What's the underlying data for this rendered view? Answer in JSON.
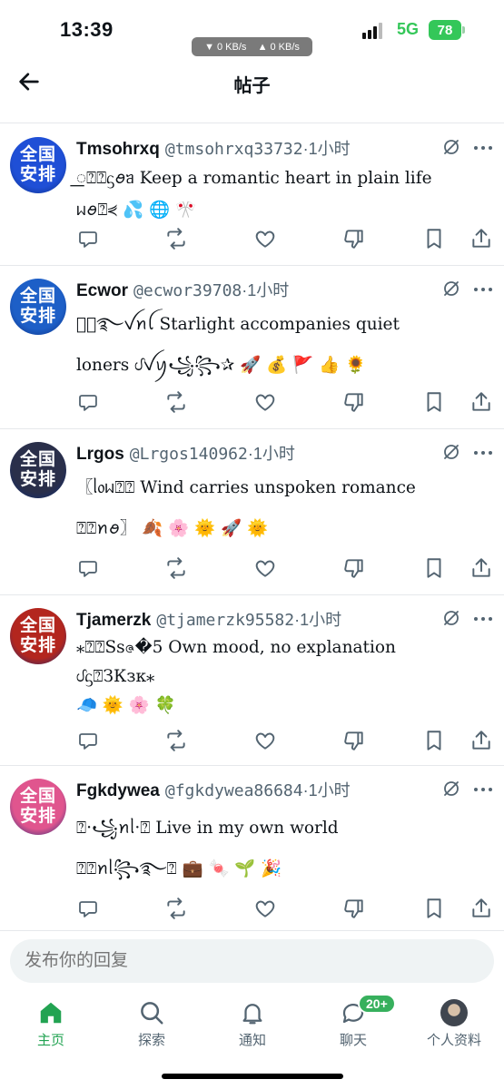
{
  "status_bar": {
    "time": "13:39",
    "net_down": "▼ 0 KB/s",
    "net_up": "▲ 0 KB/s",
    "network": "5G",
    "battery": "78"
  },
  "header": {
    "title": "帖子",
    "back_icon": "arrow-left-icon"
  },
  "posts": [
    {
      "avatar_text_1": "全国",
      "avatar_text_2": "安排",
      "avatar_color": "#1f4fd6",
      "name": "Tmsohrxq",
      "handle": "@tmsohrxq33732",
      "time": "·1小时",
      "text": "꯭⍰⍰ᦓꪮᥑ Keep a romantic heart in plain life\nᥕꪮ⍰⋞ 💦 🌐 🎌"
    },
    {
      "avatar_text_1": "全国",
      "avatar_text_2": "安排",
      "avatar_color": "#1d5fc7",
      "name": "Ecwor",
      "handle": "@ecwor39708",
      "time": "·1小时",
      "text": "✰꯭࿐ꪜꪀꪶ Starlight accompanies quiet\nloners ᦔꪜꪗ꧁꧂✰ 🚀 💰 🚩 👍 🌻"
    },
    {
      "avatar_text_1": "全国",
      "avatar_text_2": "安排",
      "avatar_color": "#2a2f4a",
      "name": "Lrgos",
      "handle": "@Lrgos140962",
      "time": "·1小时",
      "text": "〖ᥣ᥆ᥕ⍰⍰ Wind carries unspoken romance\n⍰⍰ꪀꪮ〗 🍂 🌸 🌞 🚀 🌞"
    },
    {
      "avatar_text_1": "全国",
      "avatar_text_2": "安排",
      "avatar_color": "#b3261e",
      "name": "Tjamerzk",
      "handle": "@tjamerzk95582",
      "time": "·1小时",
      "text": "⁎⍰⍰Ssဇ�5 Own mood, no explanation\nᦔᦓ⍰ЗКзк⁎\n🧢 🌞 🌸 🍀"
    },
    {
      "avatar_text_1": "全国",
      "avatar_text_2": "安排",
      "avatar_color": "#e0558e",
      "name": "Fgkdywea",
      "handle": "@fgkdywea86684",
      "time": "·1小时",
      "text": "⍰·꧁ꪀᥣ·⍰ Live in my own world\n⍰⍰ꪀᥣ꧂࿐⍰ 💼 🍬 🌱 🎉"
    }
  ],
  "reply": {
    "placeholder": "发布你的回复"
  },
  "tabbar": {
    "home": "主页",
    "search": "探索",
    "notifications": "通知",
    "chat": "聊天",
    "chat_badge": "20+",
    "profile": "个人资料",
    "active_color": "#22a352"
  }
}
